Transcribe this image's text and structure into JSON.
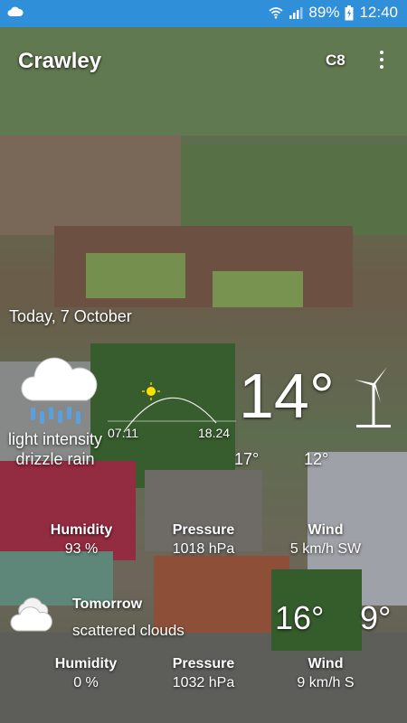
{
  "status_bar": {
    "battery": "89%",
    "time": "12:40",
    "icons": [
      "weather-cloud-icon",
      "wifi-icon",
      "signal-icon",
      "battery-icon"
    ]
  },
  "app_bar": {
    "city": "Crawley",
    "unit": "C8",
    "menu_icon": "overflow-menu-icon"
  },
  "today": {
    "date": "Today, 7 October",
    "condition_icon": "rain-cloud-icon",
    "description": "light intensity drizzle rain",
    "sunrise": "07.11",
    "sunset": "18.24",
    "temperature": "14°",
    "wind_icon": "wind-turbine-icon",
    "temp_max": "17°",
    "temp_min": "12°",
    "humidity_label": "Humidity",
    "humidity": "93 %",
    "pressure_label": "Pressure",
    "pressure": "1018 hPa",
    "wind_label": "Wind",
    "wind": "5 km/h SW"
  },
  "tomorrow": {
    "label": "Tomorrow",
    "condition_icon": "cloud-icon",
    "description": "scattered clouds",
    "temp_max": "16°",
    "temp_min": "9°",
    "humidity_label": "Humidity",
    "humidity": "0 %",
    "pressure_label": "Pressure",
    "pressure": "1032 hPa",
    "wind_label": "Wind",
    "wind": "9 km/h S"
  },
  "colors": {
    "status_bar": "#2f8fd8",
    "sun": "#ffe000",
    "rain_drops": "#5aa0e0"
  }
}
